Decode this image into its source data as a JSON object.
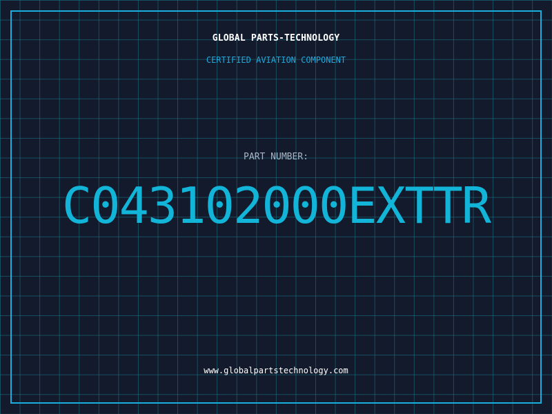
{
  "label": {
    "company": "GLOBAL PARTS-TECHNOLOGY",
    "subtitle": "CERTIFIED AVIATION COMPONENT",
    "part_number_label": "PART NUMBER:",
    "part_number": "C043102000EXTTR",
    "website": "www.globalpartstechnology.com"
  },
  "colors": {
    "background": "#121a2c",
    "grid": "#1a7a8a",
    "border": "#18aee0",
    "accent": "#12b5d8",
    "muted": "#a9b6c6",
    "text": "#ffffff"
  }
}
